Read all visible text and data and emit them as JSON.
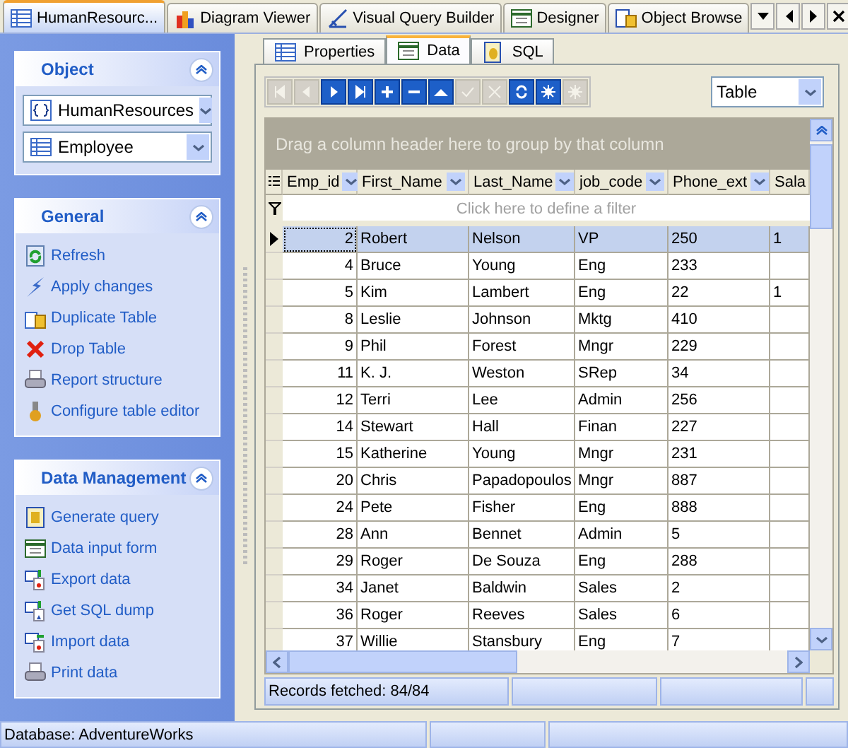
{
  "doc_tabs": [
    {
      "label": "HumanResourc...",
      "selected": true
    },
    {
      "label": "Diagram Viewer",
      "selected": false
    },
    {
      "label": "Visual Query Builder",
      "selected": false
    },
    {
      "label": "Designer",
      "selected": false
    },
    {
      "label": "Object Browse",
      "selected": false
    }
  ],
  "sidebar": {
    "panels": [
      {
        "title": "Object",
        "kind": "selectors",
        "selectors": [
          {
            "value": "HumanResources"
          },
          {
            "value": "Employee"
          }
        ]
      },
      {
        "title": "General",
        "kind": "links",
        "items": [
          {
            "label": "Refresh"
          },
          {
            "label": "Apply changes"
          },
          {
            "label": "Duplicate Table"
          },
          {
            "label": "Drop Table"
          },
          {
            "label": "Report structure"
          },
          {
            "label": "Configure table editor"
          }
        ]
      },
      {
        "title": "Data Management",
        "kind": "links",
        "items": [
          {
            "label": "Generate query"
          },
          {
            "label": "Data input form"
          },
          {
            "label": "Export data"
          },
          {
            "label": "Get SQL dump"
          },
          {
            "label": "Import data"
          },
          {
            "label": "Print data"
          }
        ]
      }
    ]
  },
  "sub_tabs": [
    {
      "label": "Properties",
      "selected": false
    },
    {
      "label": "Data",
      "selected": true
    },
    {
      "label": "SQL",
      "selected": false
    }
  ],
  "nav_buttons": [
    {
      "kind": "first",
      "disabled": true
    },
    {
      "kind": "prev",
      "disabled": true
    },
    {
      "kind": "next",
      "disabled": false
    },
    {
      "kind": "last",
      "disabled": false
    },
    {
      "kind": "add",
      "disabled": false
    },
    {
      "kind": "remove",
      "disabled": false
    },
    {
      "kind": "up",
      "disabled": false
    },
    {
      "kind": "post",
      "disabled": true
    },
    {
      "kind": "cancel",
      "disabled": true
    },
    {
      "kind": "refresh",
      "disabled": false
    },
    {
      "kind": "new",
      "disabled": false
    },
    {
      "kind": "new",
      "disabled": true
    }
  ],
  "view_select": {
    "value": "Table"
  },
  "group_panel": "Drag a column header here to group by that column",
  "table": {
    "columns": [
      "Emp_id",
      "First_Name",
      "Last_Name",
      "job_code",
      "Phone_ext",
      "Sala"
    ],
    "filter_hint": "Click here to define a filter",
    "rows": [
      {
        "selected": true,
        "cells": [
          "2",
          "Robert",
          "Nelson",
          "VP",
          "250",
          "1"
        ]
      },
      {
        "selected": false,
        "cells": [
          "4",
          "Bruce",
          "Young",
          "Eng",
          "233",
          ""
        ]
      },
      {
        "selected": false,
        "cells": [
          "5",
          "Kim",
          "Lambert",
          "Eng",
          "22",
          "1"
        ]
      },
      {
        "selected": false,
        "cells": [
          "8",
          "Leslie",
          "Johnson",
          "Mktg",
          "410",
          ""
        ]
      },
      {
        "selected": false,
        "cells": [
          "9",
          "Phil",
          "Forest",
          "Mngr",
          "229",
          ""
        ]
      },
      {
        "selected": false,
        "cells": [
          "11",
          "K. J.",
          "Weston",
          "SRep",
          "34",
          ""
        ]
      },
      {
        "selected": false,
        "cells": [
          "12",
          "Terri",
          "Lee",
          "Admin",
          "256",
          ""
        ]
      },
      {
        "selected": false,
        "cells": [
          "14",
          "Stewart",
          "Hall",
          "Finan",
          "227",
          ""
        ]
      },
      {
        "selected": false,
        "cells": [
          "15",
          "Katherine",
          "Young",
          "Mngr",
          "231",
          ""
        ]
      },
      {
        "selected": false,
        "cells": [
          "20",
          "Chris",
          "Papadopoulos",
          "Mngr",
          "887",
          ""
        ]
      },
      {
        "selected": false,
        "cells": [
          "24",
          "Pete",
          "Fisher",
          "Eng",
          "888",
          ""
        ]
      },
      {
        "selected": false,
        "cells": [
          "28",
          "Ann",
          "Bennet",
          "Admin",
          "5",
          ""
        ]
      },
      {
        "selected": false,
        "cells": [
          "29",
          "Roger",
          "De Souza",
          "Eng",
          "288",
          ""
        ]
      },
      {
        "selected": false,
        "cells": [
          "34",
          "Janet",
          "Baldwin",
          "Sales",
          "2",
          ""
        ]
      },
      {
        "selected": false,
        "cells": [
          "36",
          "Roger",
          "Reeves",
          "Sales",
          "6",
          ""
        ]
      },
      {
        "selected": false,
        "cells": [
          "37",
          "Willie",
          "Stansbury",
          "Eng",
          "7",
          ""
        ]
      }
    ]
  },
  "records_status": "Records fetched: 84/84",
  "status_bar": "Database: AdventureWorks"
}
